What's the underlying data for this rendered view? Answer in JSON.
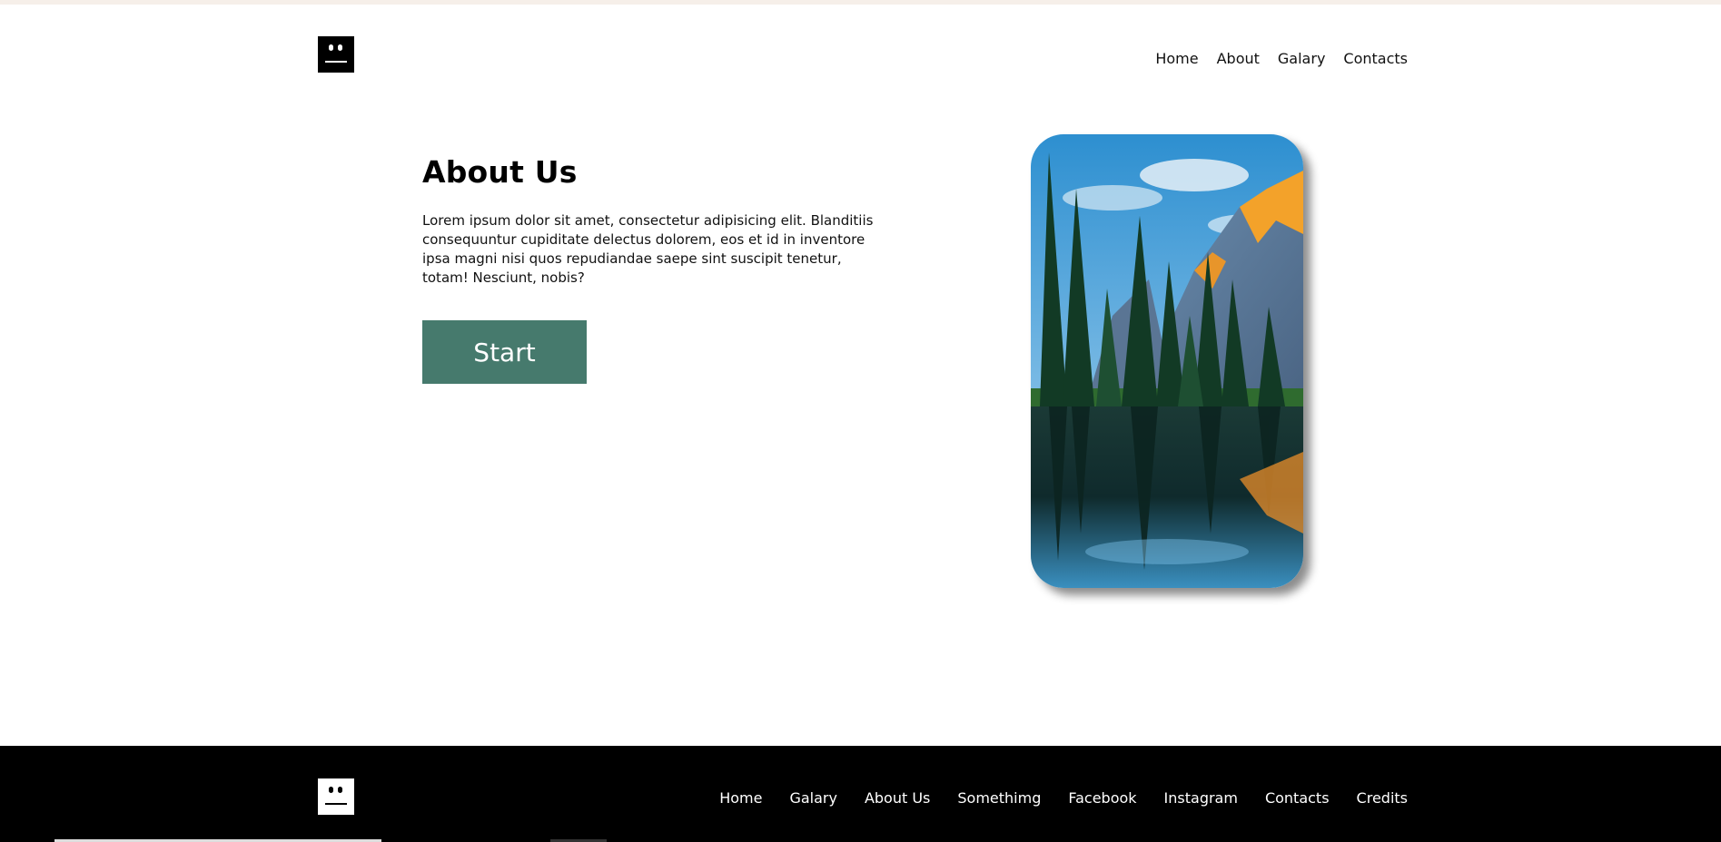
{
  "header": {
    "logo": "face-logo-icon",
    "nav": [
      "Home",
      "About",
      "Galary",
      "Contacts"
    ]
  },
  "about": {
    "title": "About Us",
    "body": "Lorem ipsum dolor sit amet, consectetur adipisicing elit. Blanditiis consequuntur cupiditate delectus dolorem, eos et id in inventore ipsa magni nisi quos repudiandae saepe sint suscipit tenetur, totam! Nesciunt, nobis?",
    "button_label": "Start",
    "button_color": "#467a6d"
  },
  "image": {
    "subject": "mountain-lake-forest-photo"
  },
  "footer": {
    "logo": "face-logo-icon",
    "nav": [
      "Home",
      "Galary",
      "About Us",
      "Somethimg",
      "Facebook",
      "Instagram",
      "Contacts",
      "Credits"
    ]
  }
}
